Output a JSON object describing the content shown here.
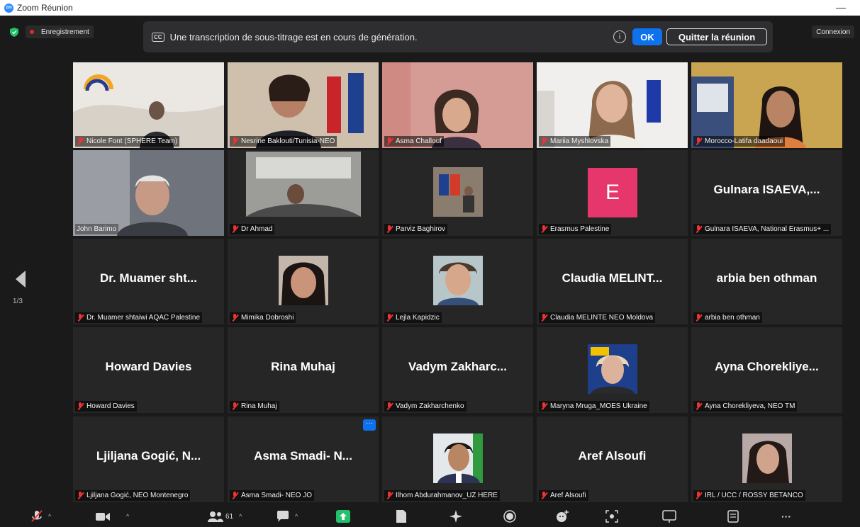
{
  "window": {
    "title": "Zoom Réunion",
    "minimize": "—"
  },
  "topbar": {
    "recording_label": "Enregistrement",
    "connexion_label": "Connexion"
  },
  "banner": {
    "cc_icon": "CC",
    "message": "Une transcription de sous-titrage est en cours de génération.",
    "info_icon": "i",
    "ok_label": "OK",
    "leave_label": "Quitter la réunion"
  },
  "pager": {
    "page": "1/3"
  },
  "tiles": [
    {
      "label": "Nicole Font (SPHERE Team)",
      "big": "",
      "video": true,
      "bg": "#e4e1dc"
    },
    {
      "label": "Nesrine Baklouti/Tunisia-NEO",
      "big": "",
      "video": true,
      "bg": "#d8c6b3"
    },
    {
      "label": "Asma Challouf",
      "big": "",
      "video": true,
      "bg": "#d9a79e"
    },
    {
      "label": "Mariia Myshlovska",
      "big": "",
      "video": true,
      "bg": "#e9e7e4"
    },
    {
      "label": "Morocco-Latifa daadaoui",
      "big": "",
      "video": true,
      "bg": "#c3a45a"
    },
    {
      "label": "John Barimo",
      "big": "",
      "video": true,
      "bg": "#6d7179"
    },
    {
      "label": "Dr Ahmad",
      "big": "",
      "video": true,
      "bg": "#8e8f8c"
    },
    {
      "label": "Parviz Baghirov",
      "big": "",
      "video": true,
      "bg": "#262626"
    },
    {
      "label": "Erasmus Palestine",
      "big": "",
      "video": false,
      "bg": "#262626"
    },
    {
      "label": "Gulnara ISAEVA, National Erasmus+ ...",
      "big": "Gulnara ISAEVA,...",
      "video": false,
      "bg": "#262626"
    },
    {
      "label": "Dr. Muamer shtaiwi AQAC Palestine",
      "big": "Dr. Muamer sht...",
      "video": false,
      "bg": "#262626"
    },
    {
      "label": "Mimika Dobroshi",
      "big": "",
      "video": true,
      "bg": "#262626"
    },
    {
      "label": "Lejla Kapidzic",
      "big": "",
      "video": true,
      "bg": "#262626"
    },
    {
      "label": "Claudia MELINTE NEO Moldova",
      "big": "Claudia  MELINT...",
      "video": false,
      "bg": "#262626"
    },
    {
      "label": "arbia ben othman",
      "big": "arbia ben othman",
      "video": false,
      "bg": "#262626"
    },
    {
      "label": "Howard Davies",
      "big": "Howard Davies",
      "video": false,
      "bg": "#262626"
    },
    {
      "label": "Rina Muhaj",
      "big": "Rina Muhaj",
      "video": false,
      "bg": "#262626"
    },
    {
      "label": "Vadym Zakharchenko",
      "big": "Vadym  Zakharc...",
      "video": false,
      "bg": "#262626"
    },
    {
      "label": "Maryna Mruga_MOES Ukraine",
      "big": "",
      "video": true,
      "bg": "#262626"
    },
    {
      "label": "Ayna Chorekliyeva, NEO TM",
      "big": "Ayna  Chorekliye...",
      "video": false,
      "bg": "#262626"
    },
    {
      "label": "Ljiljana Gogić, NEO Montenegro",
      "big": "Ljiljana  Gogić,  N...",
      "video": false,
      "bg": "#262626"
    },
    {
      "label": "Asma Smadi- NEO JO",
      "big": "Asma Smadi- N...",
      "video": false,
      "bg": "#262626"
    },
    {
      "label": "Ilhom Abdurahmanov_UZ HERE",
      "big": "",
      "video": true,
      "bg": "#262626"
    },
    {
      "label": "Aref Alsoufi",
      "big": "Aref Alsoufi",
      "video": false,
      "bg": "#262626"
    },
    {
      "label": "IRL / UCC / ROSSY BETANCO",
      "big": "",
      "video": true,
      "bg": "#262626"
    }
  ],
  "avatar_letter": "E",
  "more_options": "···",
  "toolbar": {
    "participants_count": "61",
    "more_label": "···"
  },
  "colors": {
    "accent": "#0e72ed",
    "active_speaker": "#d9ea73",
    "muted": "#e33333",
    "avatar_pink": "#e6376d"
  }
}
